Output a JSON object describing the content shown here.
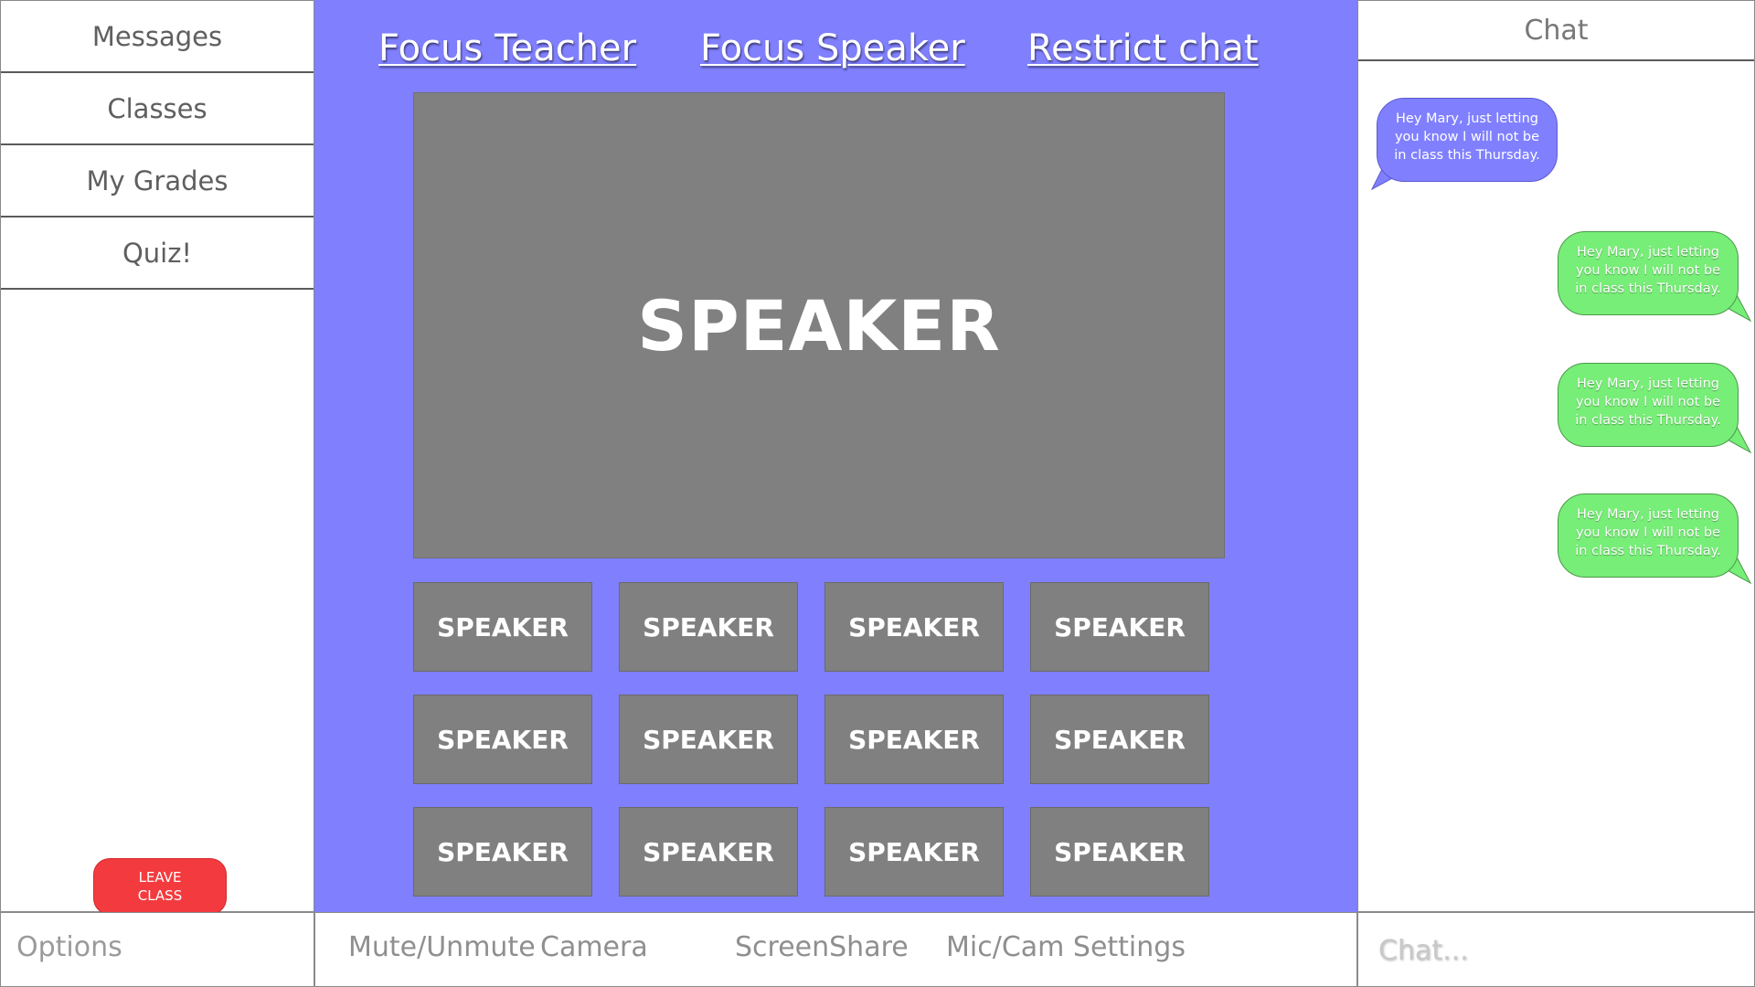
{
  "sidebar": {
    "items": [
      {
        "label": "Messages"
      },
      {
        "label": "Classes"
      },
      {
        "label": "My Grades"
      },
      {
        "label": "Quiz!"
      }
    ],
    "leave_button": "LEAVE CLASS"
  },
  "stage": {
    "links": {
      "focus_teacher": "Focus Teacher",
      "focus_speaker": "Focus Speaker",
      "restrict_chat": "Restrict chat"
    },
    "main_speaker_label": "SPEAKER",
    "tiles": [
      "SPEAKER",
      "SPEAKER",
      "SPEAKER",
      "SPEAKER",
      "SPEAKER",
      "SPEAKER",
      "SPEAKER",
      "SPEAKER",
      "SPEAKER",
      "SPEAKER",
      "SPEAKER",
      "SPEAKER"
    ]
  },
  "chat": {
    "title": "Chat",
    "messages": [
      {
        "direction": "incoming",
        "text": "Hey Mary, just letting you know I will not be in class this Thursday."
      },
      {
        "direction": "outgoing",
        "text": "Hey Mary, just letting you know I will not be in class this Thursday."
      },
      {
        "direction": "outgoing",
        "text": "Hey Mary, just letting you know I will not be in class this Thursday."
      },
      {
        "direction": "outgoing",
        "text": "Hey Mary, just letting you know I will not be in class this Thursday."
      }
    ],
    "input_placeholder": "Chat..."
  },
  "bottom": {
    "options_label": "Options",
    "controls": {
      "mute": "Mute/Unmute",
      "camera": "Camera",
      "screenshare": "ScreenShare",
      "settings": "Mic/Cam Settings"
    }
  },
  "colors": {
    "stage_bg": "#8080ff",
    "tile_bg": "#808080",
    "incoming_bubble": "#8080ff",
    "outgoing_bubble": "#77ee77",
    "leave_button": "#f33b3f"
  }
}
